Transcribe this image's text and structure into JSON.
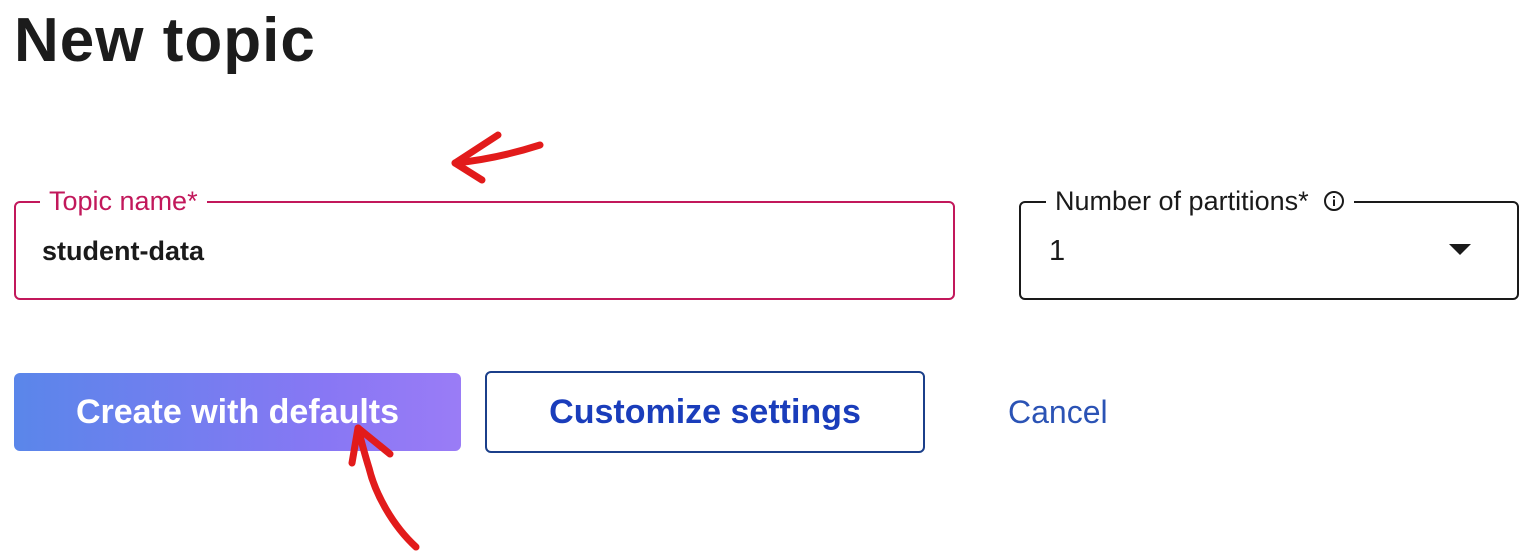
{
  "page": {
    "title": "New topic"
  },
  "form": {
    "topic_name": {
      "label": "Topic name*",
      "value": "student-data"
    },
    "partitions": {
      "label": "Number of partitions*",
      "value": "1",
      "info_icon": "info-icon"
    }
  },
  "actions": {
    "create_label": "Create with defaults",
    "customize_label": "Customize settings",
    "cancel_label": "Cancel"
  },
  "colors": {
    "focus_accent": "#c2185b",
    "primary_gradient_start": "#5a86ea",
    "primary_gradient_end": "#9a7cf6",
    "secondary_text": "#1a3dbb",
    "annotation": "#e21b1b"
  }
}
